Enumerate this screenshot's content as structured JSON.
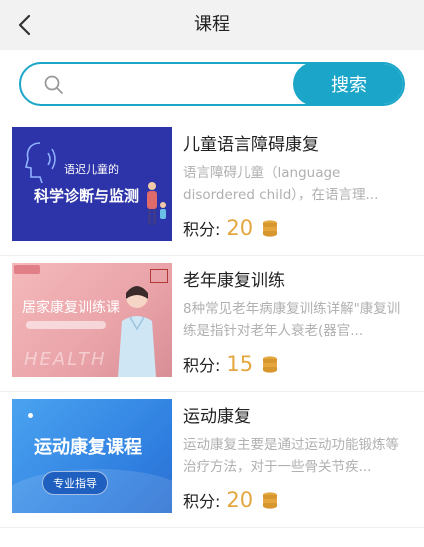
{
  "header": {
    "title": "课程"
  },
  "search": {
    "placeholder": "",
    "button_label": "搜索"
  },
  "colors": {
    "accent": "#1ba6c9",
    "points": "#e4a740"
  },
  "courses": [
    {
      "title": "儿童语言障碍康复",
      "description": "语言障碍儿童（language disordered child），在语言理...",
      "points_label": "积分:",
      "points": "20",
      "thumb_line1": "语迟儿童的",
      "thumb_line2": "科学诊断与监测"
    },
    {
      "title": "老年康复训练",
      "description": "8种常见老年病康复训练详解\"康复训练是指针对老年人衰老(器官...",
      "points_label": "积分:",
      "points": "15",
      "thumb_line1": "居家康复训练课",
      "thumb_line2": "HEALTH"
    },
    {
      "title": "运动康复",
      "description": "运动康复主要是通过运动功能锻炼等治疗方法，对于一些骨关节疾...",
      "points_label": "积分:",
      "points": "20",
      "thumb_line1": "运动康复课程",
      "thumb_line2": "专业指导"
    }
  ]
}
